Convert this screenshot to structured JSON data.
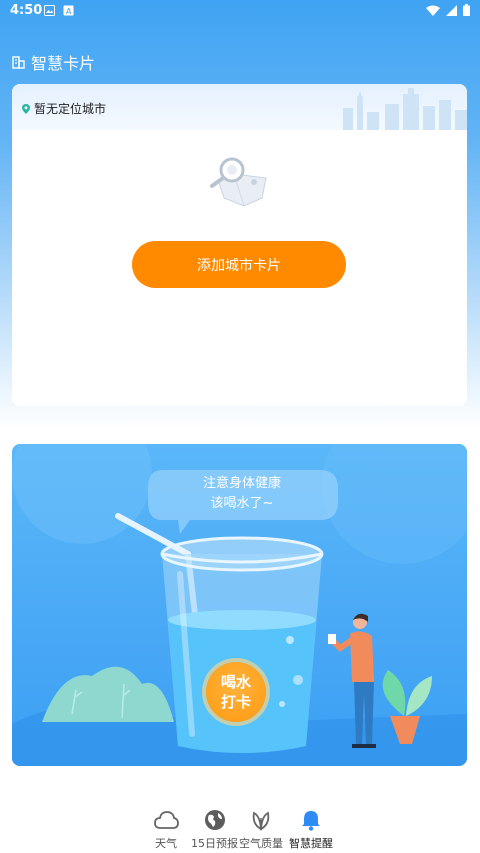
{
  "status_bar": {
    "time": "4:50"
  },
  "header": {
    "title": "智慧卡片"
  },
  "city_card": {
    "location_text": "暂无定位城市",
    "add_button_label": "添加城市卡片"
  },
  "water_card": {
    "bubble_line1": "注意身体健康",
    "bubble_line2": "该喝水了~",
    "checkin_line1": "喝水",
    "checkin_line2": "打卡"
  },
  "bottom_nav": {
    "items": [
      {
        "label": "天气",
        "icon": "cloud-icon"
      },
      {
        "label": "15日预报",
        "icon": "globe-icon"
      },
      {
        "label": "空气质量",
        "icon": "leaf-icon"
      },
      {
        "label": "智慧提醒",
        "icon": "bell-icon"
      }
    ],
    "active_color": "#2f8cf5"
  },
  "colors": {
    "accent": "#ff8a00",
    "primary_blue": "#3fa3f3"
  }
}
